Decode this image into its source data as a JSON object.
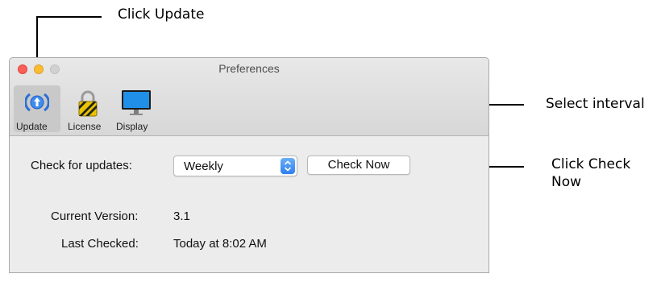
{
  "callouts": {
    "click_update": "Click Update",
    "select_interval": "Select interval",
    "click_check_now_line1": "Click Check",
    "click_check_now_line2": "Now"
  },
  "window": {
    "title": "Preferences",
    "toolbar": [
      {
        "label": "Update",
        "icon": "update-icon",
        "selected": true
      },
      {
        "label": "License",
        "icon": "lock-icon",
        "selected": false
      },
      {
        "label": "Display",
        "icon": "monitor-icon",
        "selected": false
      }
    ]
  },
  "update_pane": {
    "check_label": "Check for updates:",
    "interval_value": "Weekly",
    "check_now_label": "Check Now",
    "current_version_label": "Current Version:",
    "current_version_value": "3.1",
    "last_checked_label": "Last Checked:",
    "last_checked_value": "Today at 8:02 AM"
  },
  "colors": {
    "accent": "#2f7fef",
    "close": "#fc5f57",
    "minimize": "#fdbc2e"
  }
}
